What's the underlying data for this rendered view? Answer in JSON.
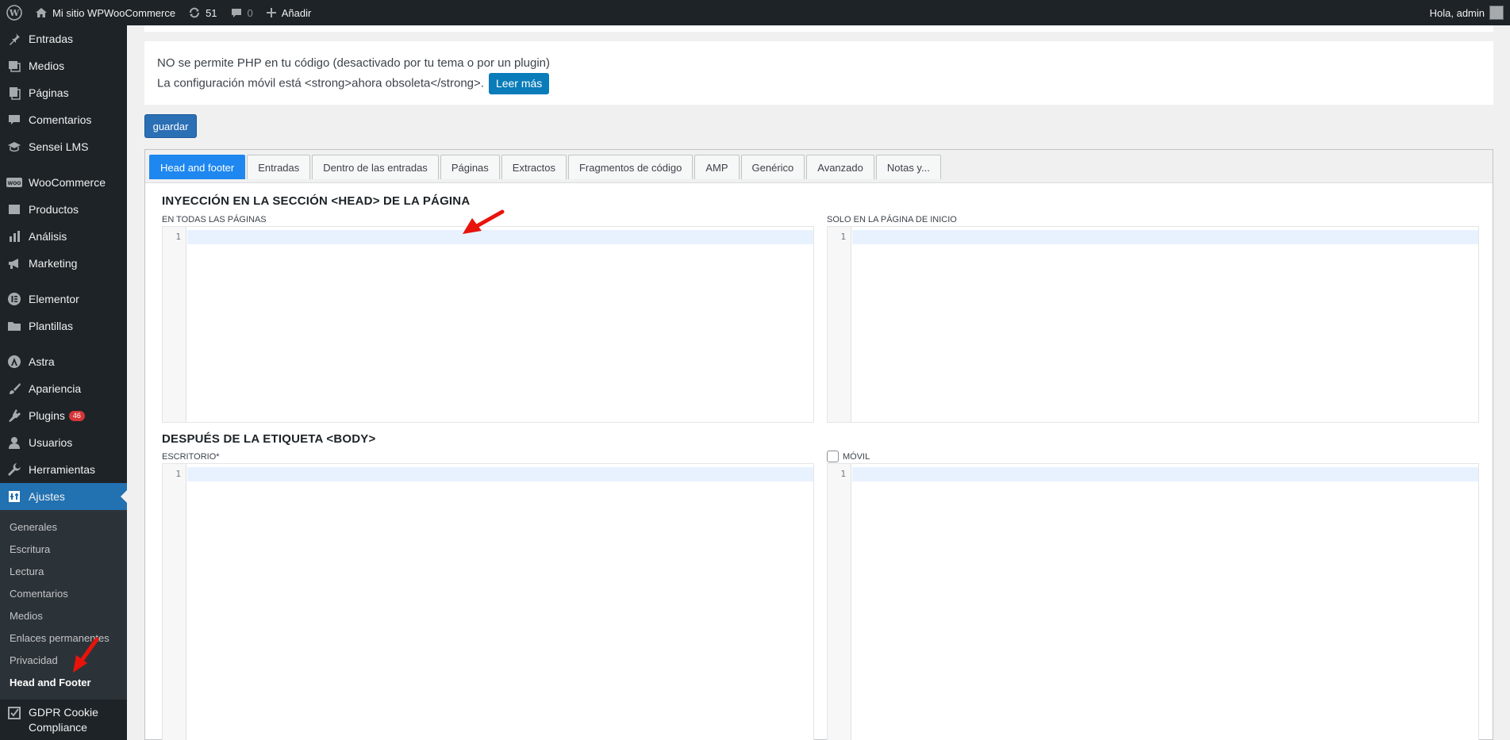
{
  "adminbar": {
    "site_name": "Mi sitio WPWooCommerce",
    "updates_count": "51",
    "comments_count": "0",
    "add_label": "Añadir",
    "greeting": "Hola, admin"
  },
  "sidebar": {
    "items": [
      {
        "label": "Entradas",
        "icon": "pin-icon"
      },
      {
        "label": "Medios",
        "icon": "media-icon"
      },
      {
        "label": "Páginas",
        "icon": "pages-icon"
      },
      {
        "label": "Comentarios",
        "icon": "comments-icon"
      },
      {
        "label": "Sensei LMS",
        "icon": "sensei-icon"
      },
      {
        "label": "WooCommerce",
        "icon": "woo-icon"
      },
      {
        "label": "Productos",
        "icon": "products-icon"
      },
      {
        "label": "Análisis",
        "icon": "analytics-icon"
      },
      {
        "label": "Marketing",
        "icon": "megaphone-icon"
      },
      {
        "label": "Elementor",
        "icon": "elementor-icon"
      },
      {
        "label": "Plantillas",
        "icon": "folder-icon"
      },
      {
        "label": "Astra",
        "icon": "astra-icon"
      },
      {
        "label": "Apariencia",
        "icon": "brush-icon"
      },
      {
        "label": "Plugins",
        "icon": "plugin-icon",
        "badge": "46"
      },
      {
        "label": "Usuarios",
        "icon": "user-icon"
      },
      {
        "label": "Herramientas",
        "icon": "wrench-icon"
      },
      {
        "label": "Ajustes",
        "icon": "settings-icon"
      }
    ],
    "submenu": [
      "Generales",
      "Escritura",
      "Lectura",
      "Comentarios",
      "Medios",
      "Enlaces permanentes",
      "Privacidad",
      "Head and Footer"
    ],
    "gdpr_line1": "GDPR Cookie",
    "gdpr_line2": "Compliance"
  },
  "notice": {
    "line1": "NO se permite PHP en tu código (desactivado por tu tema o por un plugin)",
    "line2": "La configuración móvil está <strong>ahora obsoleta</strong>.",
    "read_more": "Leer más"
  },
  "save_label": "guardar",
  "tabs": [
    "Head and footer",
    "Entradas",
    "Dentro de las entradas",
    "Páginas",
    "Extractos",
    "Fragmentos de código",
    "AMP",
    "Genérico",
    "Avanzado",
    "Notas y..."
  ],
  "section_head": {
    "title": "INYECCIÓN EN LA SECCIÓN <HEAD> DE LA PÁGINA",
    "left_label": "EN TODAS LAS PÁGINAS",
    "right_label": "SOLO EN LA PÁGINA DE INICIO"
  },
  "section_body": {
    "title": "DESPUÉS DE LA ETIQUETA <BODY>",
    "left_label": "ESCRITORIO*",
    "right_label": "MÓVIL"
  },
  "line_number": "1",
  "colors": {
    "admin_dark": "#1d2327",
    "accent_blue": "#2271b1",
    "tab_active": "#1e87f0",
    "arrow_red": "#e8130b"
  }
}
